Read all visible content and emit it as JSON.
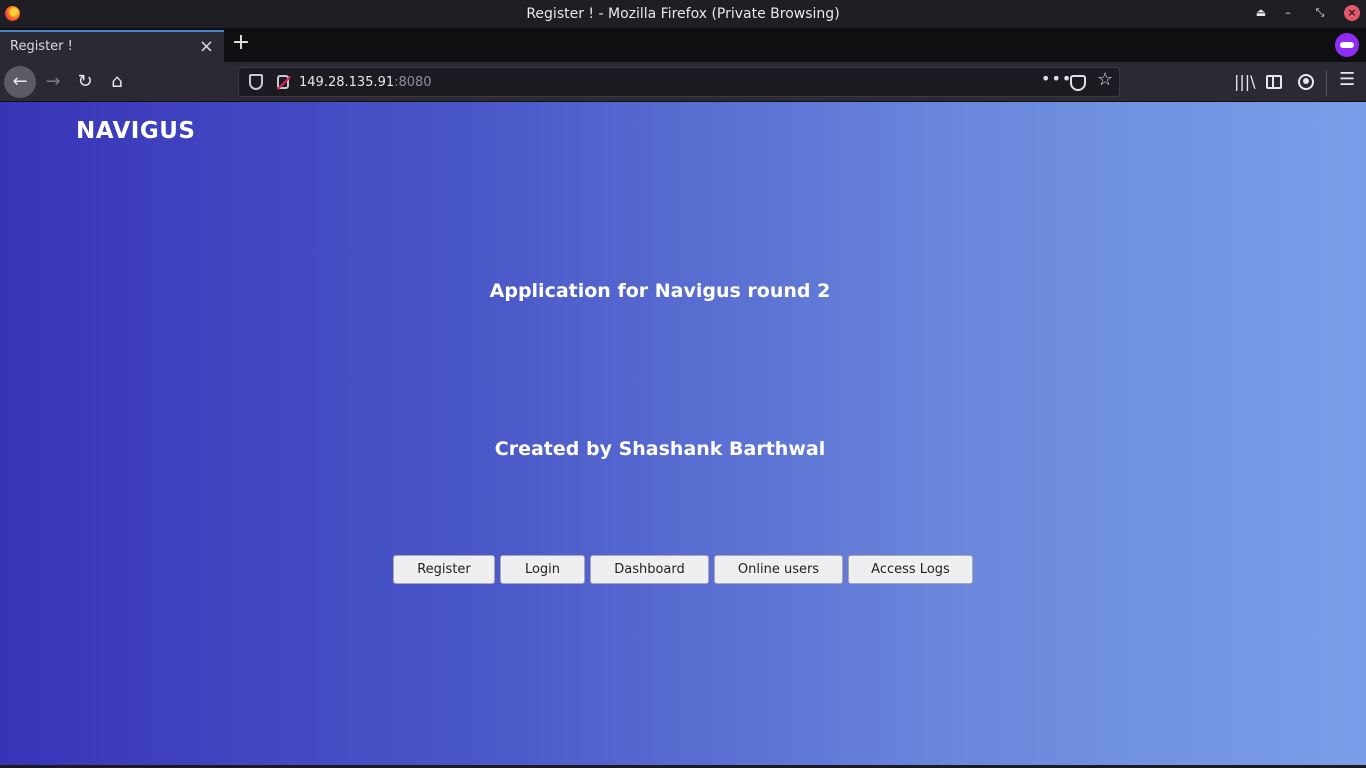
{
  "window": {
    "title": "Register ! - Mozilla Firefox (Private Browsing)"
  },
  "tabs": [
    {
      "label": "Register !",
      "active": true
    }
  ],
  "urlbar": {
    "host": "149.28.135.91",
    "port": ":8080"
  },
  "page": {
    "brand": "NAVIGUS",
    "headline": "Application for Navigus round 2",
    "credit": "Created by Shashank Barthwal",
    "buttons": [
      "Register",
      "Login",
      "Dashboard",
      "Online users",
      "Access Logs"
    ]
  },
  "colors": {
    "gradient_start": "#3834b8",
    "gradient_end": "#7a9ee8",
    "private_badge": "#8f2df5",
    "tab_accent": "#4a86c7"
  },
  "icons": [
    "firefox-logo-icon",
    "eject-icon",
    "minimize-icon",
    "restore-icon",
    "close-icon",
    "new-tab-icon",
    "private-browsing-icon",
    "back-arrow-icon",
    "forward-arrow-icon",
    "reload-icon",
    "home-icon",
    "shield-icon",
    "insecure-lock-icon",
    "more-actions-icon",
    "pocket-icon",
    "bookmark-star-icon",
    "library-icon",
    "sidebar-icon",
    "account-icon",
    "hamburger-menu-icon"
  ]
}
